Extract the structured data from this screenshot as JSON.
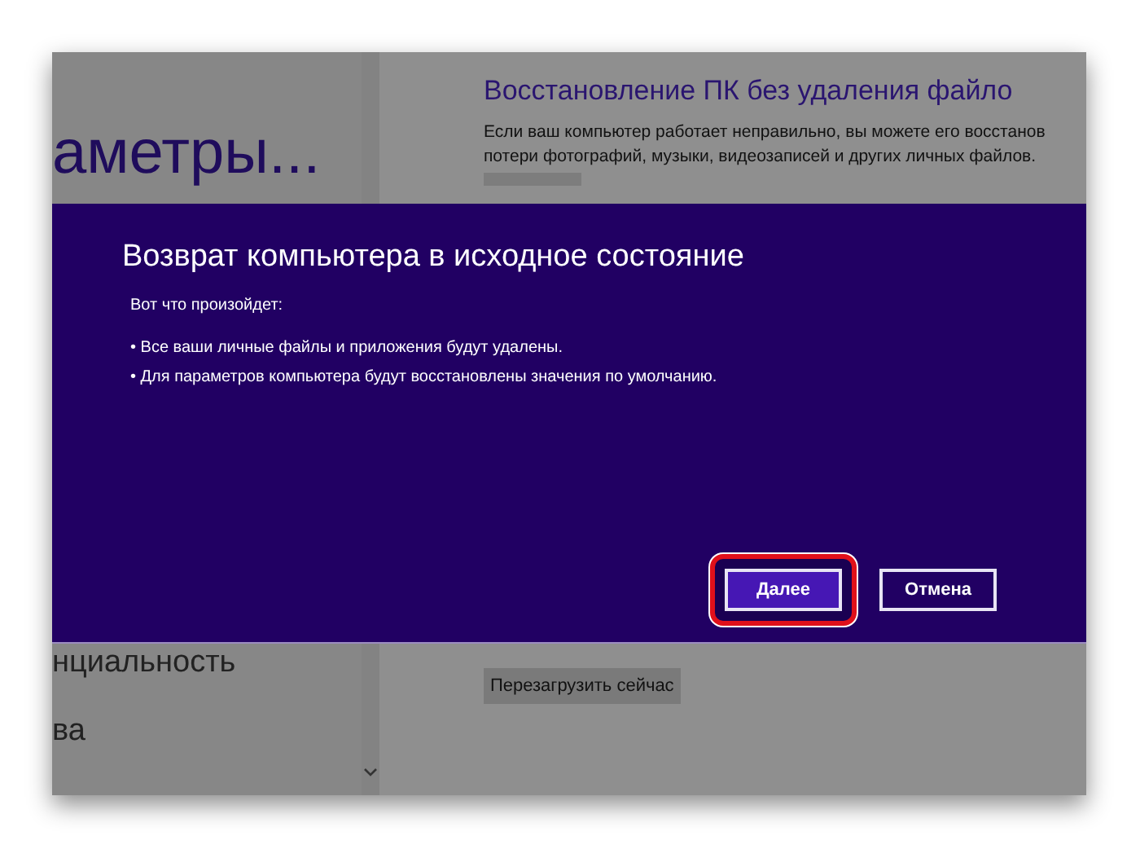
{
  "settings_pane": {
    "title": "аметры...",
    "items": [
      "нциальность",
      "ва"
    ]
  },
  "recovery_section": {
    "title": "Восстановление ПК без удаления файло",
    "description": [
      "Если ваш компьютер работает неправильно, вы можете его восстанов",
      "потери фотографий, музыки, видеозаписей и других личных файлов."
    ],
    "restart_button": "Перезагрузить сейчас"
  },
  "dialog": {
    "title": "Возврат компьютера в исходное состояние",
    "intro": "Вот что произойдет:",
    "bullets": [
      "• Все ваши личные файлы и приложения будут удалены.",
      "• Для параметров компьютера будут восстановлены значения по умолчанию."
    ],
    "buttons": [
      {
        "label": "Далее",
        "kind": "primary",
        "highlighted": true
      },
      {
        "label": "Отмена",
        "kind": "secondary",
        "highlighted": false
      }
    ]
  }
}
